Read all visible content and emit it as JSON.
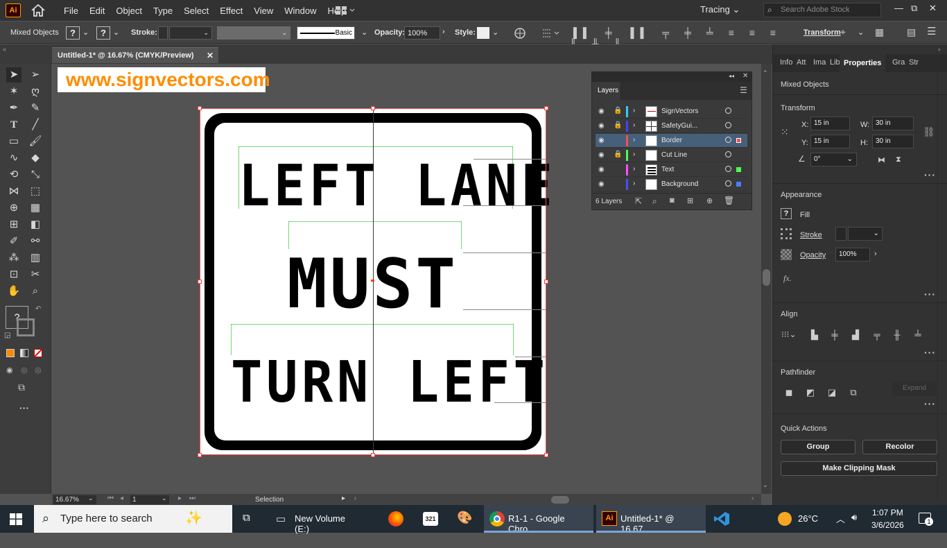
{
  "app": {
    "logo": "Ai",
    "menus": [
      "File",
      "Edit",
      "Object",
      "Type",
      "Select",
      "Effect",
      "View",
      "Window",
      "Help"
    ],
    "workspace": "Tracing",
    "search_placeholder": "Search Adobe Stock"
  },
  "controlbar": {
    "selection": "Mixed Objects",
    "stroke_label": "Stroke:",
    "brush_label": "Basic",
    "opacity_label": "Opacity:",
    "opacity_value": "100%",
    "style_label": "Style:",
    "transform_label": "Transform"
  },
  "document": {
    "tab_title": "Untitled-1* @ 16.67% (CMYK/Preview)",
    "watermark": "www.signvectors.com",
    "sign_lines": [
      "LEFT LANE",
      "MUST",
      "TURN LEFT"
    ]
  },
  "layers": {
    "title": "Layers",
    "count": "6 Layers",
    "items": [
      {
        "name": "SignVectors",
        "color": "#33ccff",
        "locked": true
      },
      {
        "name": "SafetyGui...",
        "color": "#4444ff",
        "locked": true
      },
      {
        "name": "Border",
        "color": "#ff4d4d",
        "locked": false
      },
      {
        "name": "Cut Line",
        "color": "#4dff4d",
        "locked": false
      },
      {
        "name": "Text",
        "color": "#ff4dff",
        "locked": false
      },
      {
        "name": "Background",
        "color": "#4d4dff",
        "locked": false
      }
    ]
  },
  "properties": {
    "tabs": [
      "Info",
      "Att",
      "Ima",
      "Lib",
      "Properties",
      "Gra",
      "Str"
    ],
    "active_tab": "Properties",
    "selection": "Mixed Objects",
    "transform_title": "Transform",
    "x": "15 in",
    "y": "15 in",
    "w": "30 in",
    "h": "30 in",
    "x_label": "X:",
    "y_label": "Y:",
    "w_label": "W:",
    "h_label": "H:",
    "rotate": "0°",
    "appearance_title": "Appearance",
    "fill_label": "Fill",
    "stroke_label": "Stroke",
    "opacity_label": "Opacity",
    "opacity_value": "100%",
    "fx_label": "fx.",
    "align_title": "Align",
    "pathfinder_title": "Pathfinder",
    "expand_label": "Expand",
    "quick_actions_title": "Quick Actions",
    "group_label": "Group",
    "recolor_label": "Recolor",
    "clipping_label": "Make Clipping Mask"
  },
  "status": {
    "zoom": "16.67%",
    "artboard": "1",
    "tool": "Selection"
  },
  "taskbar": {
    "search_placeholder": "Type here to search",
    "items": [
      {
        "label": "New Volume (E:)"
      },
      {
        "label": "R1-1 - Google Chro..."
      },
      {
        "label": "Untitled-1* @ 16.67..."
      }
    ],
    "weather": "26°C",
    "time": "1:07 PM",
    "date": "3/6/2026",
    "notification_count": "1"
  }
}
